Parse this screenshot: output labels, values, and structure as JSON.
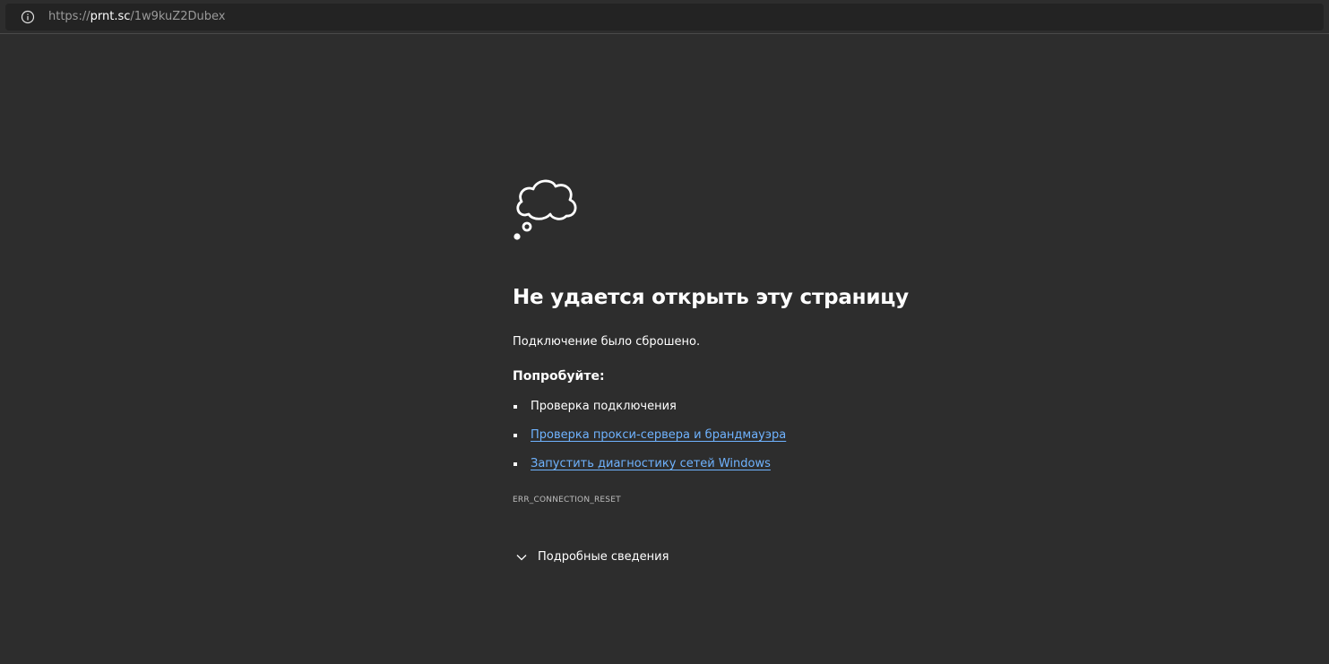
{
  "address_bar": {
    "url_protocol": "https://",
    "url_host": "prnt.sc",
    "url_path": "/1w9kuZ2Dubex",
    "info_icon": "info-circle-icon"
  },
  "error_page": {
    "icon": "thought-cloud-icon",
    "title": "Не удается открыть эту страницу",
    "subtitle": "Подключение было сброшено.",
    "try_label": "Попробуйте:",
    "suggestions": [
      {
        "label": "Проверка подключения",
        "is_link": false
      },
      {
        "label": "Проверка прокси-сервера и брандмауэра",
        "is_link": true
      },
      {
        "label": "Запустить диагностику сетей Windows",
        "is_link": true
      }
    ],
    "error_code": "ERR_CONNECTION_RESET",
    "details_label": "Подробные сведения",
    "details_icon": "chevron-down-icon"
  },
  "colors": {
    "background": "#2d2d2d",
    "address_field": "#232323",
    "text": "#ffffff",
    "link": "#6fb3ff",
    "muted": "#9a9a9a"
  }
}
